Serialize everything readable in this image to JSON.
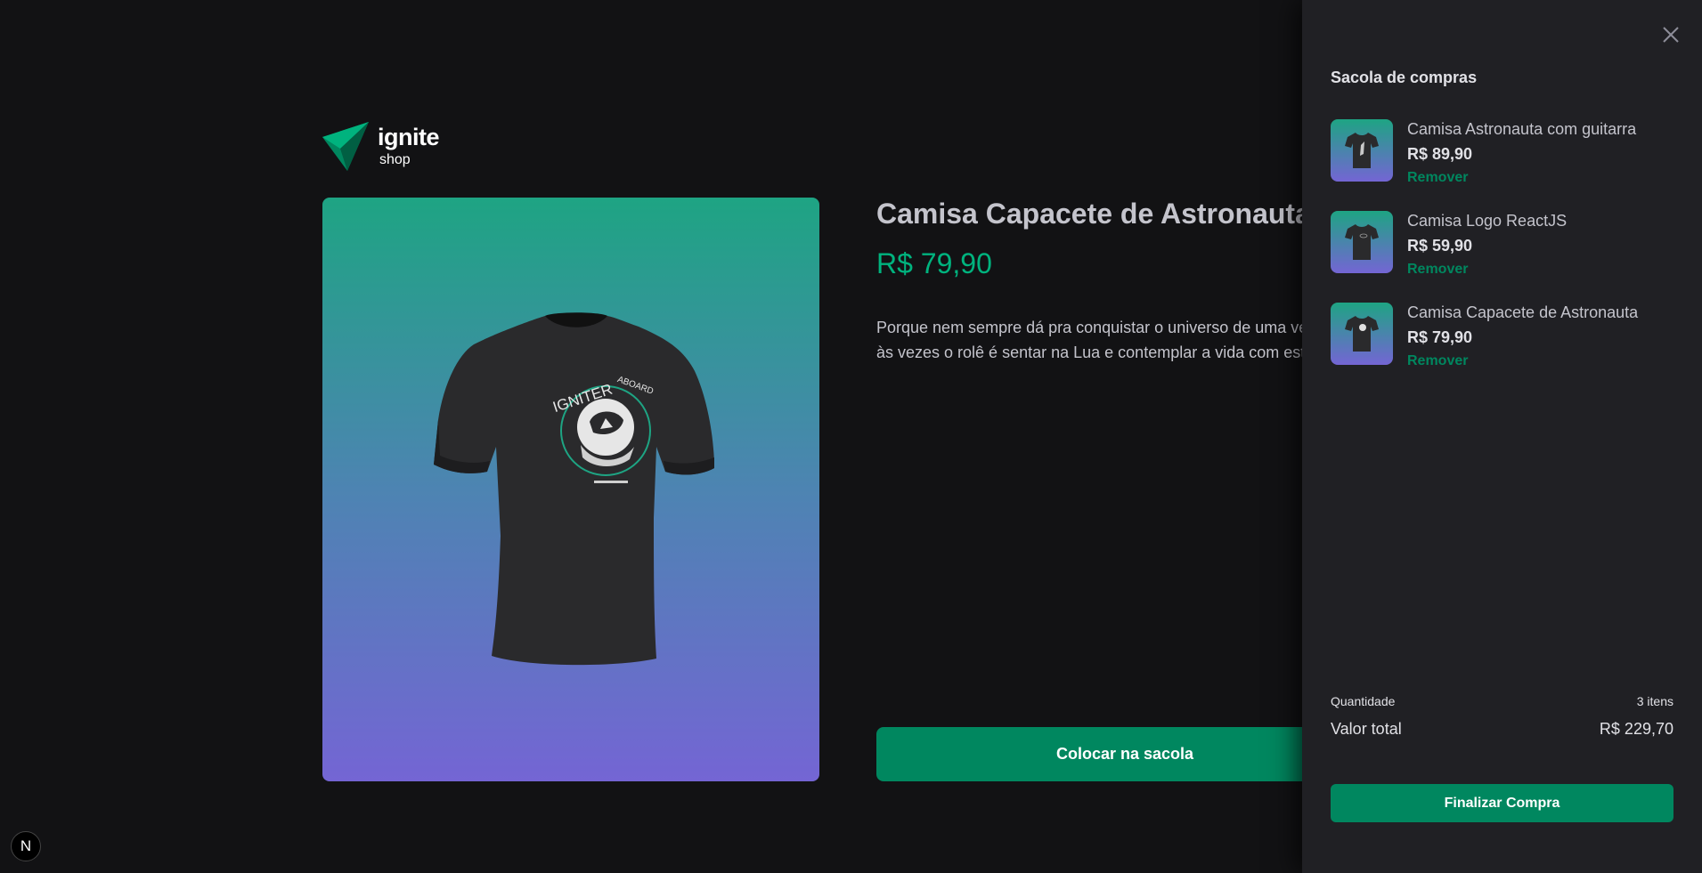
{
  "brand": {
    "name": "ignite",
    "sub": "shop",
    "logo_icon": "ignite-arrow-logo"
  },
  "product": {
    "title": "Camisa Capacete de Astronauta",
    "price": "R$ 79,90",
    "description": "Porque nem sempre dá pra conquistar o universo de uma vez, às vezes o rolê é sentar na Lua e contemplar a vida com estilo.",
    "add_button": "Colocar na sacola",
    "image_icon": "t-shirt-image"
  },
  "cart": {
    "title": "Sacola de compras",
    "close_icon": "close-icon",
    "items": [
      {
        "name": "Camisa Astronauta com guitarra",
        "price": "R$ 89,90",
        "remove": "Remover"
      },
      {
        "name": "Camisa Logo ReactJS",
        "price": "R$ 59,90",
        "remove": "Remover"
      },
      {
        "name": "Camisa Capacete de Astronauta",
        "price": "R$ 79,90",
        "remove": "Remover"
      }
    ],
    "quantity_label": "Quantidade",
    "quantity_value": "3 itens",
    "total_label": "Valor total",
    "total_value": "R$ 229,70",
    "checkout_button": "Finalizar Compra"
  },
  "next_badge": "N",
  "colors": {
    "background": "#121214",
    "panel": "#202024",
    "accent": "#00875f",
    "price": "#00b37e"
  }
}
